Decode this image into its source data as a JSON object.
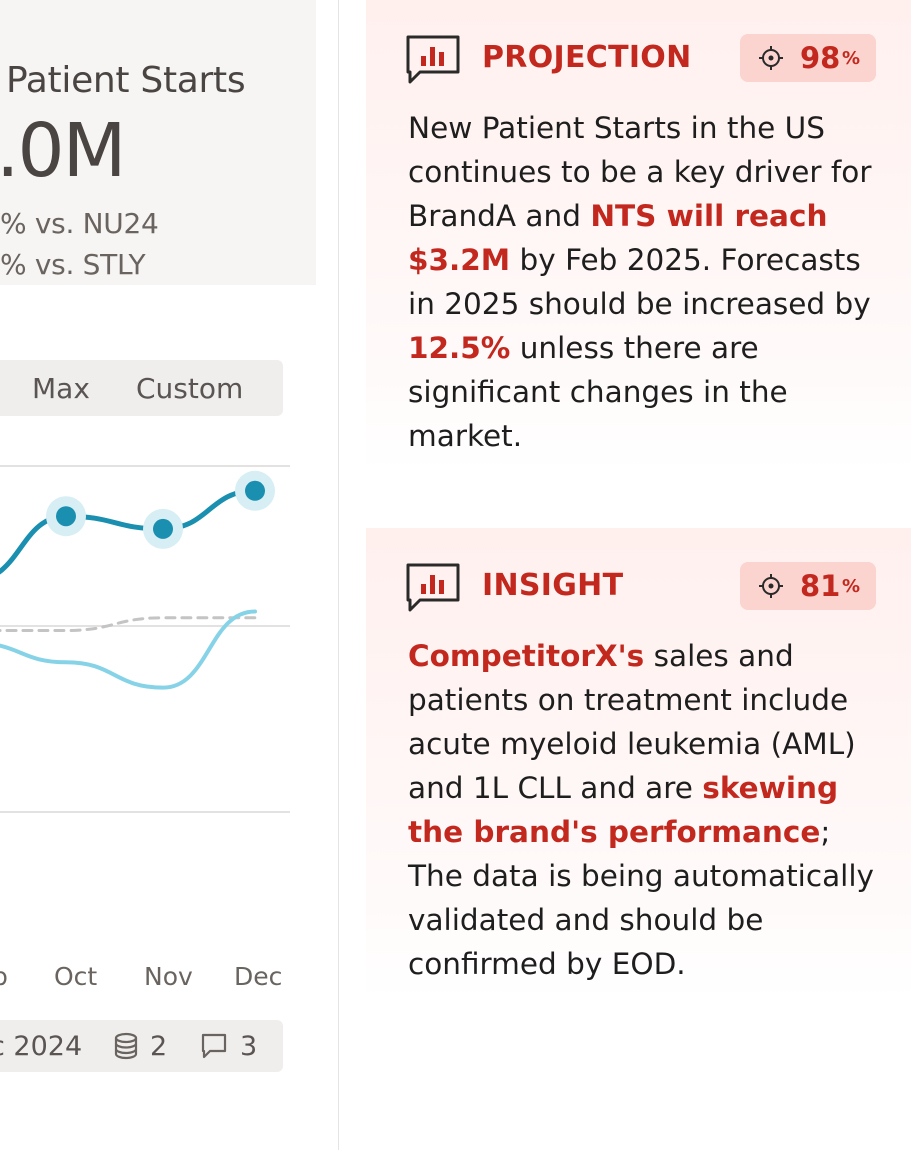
{
  "kpi": {
    "title": "Patient Starts",
    "value": ".0M",
    "delta_nu24": "% vs. NU24",
    "delta_stly": "% vs. STLY"
  },
  "range_selector": {
    "options": [
      "Max",
      "Custom"
    ]
  },
  "chart_data": {
    "type": "line",
    "categories": [
      "p",
      "Oct",
      "Nov",
      "Dec"
    ],
    "series": [
      {
        "values": [
          58,
          68,
          66,
          72
        ],
        "color": "#1a8fb0",
        "style": "solid-markers"
      },
      {
        "values": [
          48,
          45,
          41,
          53
        ],
        "color": "#86d3e8",
        "style": "solid"
      },
      {
        "values": [
          50,
          50,
          52,
          52
        ],
        "color": "#c4c4c4",
        "style": "dashed"
      }
    ],
    "ylim": [
      0,
      80
    ],
    "grid": true
  },
  "footer": {
    "date": "c 2024",
    "datasources_count": "2",
    "comments_count": "3",
    "datasource_icon": "database-icon",
    "comments_icon": "comment-icon"
  },
  "cards": [
    {
      "label": "PROJECTION",
      "icon": "bar-chart-message-icon",
      "confidence": "98",
      "confidence_unit": "%",
      "text": {
        "p1": "New Patient Starts in the US continues to be a key driver for BrandA and ",
        "h1": "NTS will reach $3.2M",
        "p2": " by Feb 2025. Forecasts in 2025 should be increased by ",
        "h2": "12.5%",
        "p3": " unless there are significant changes in the market."
      }
    },
    {
      "label": "INSIGHT",
      "icon": "bar-chart-message-icon",
      "confidence": "81",
      "confidence_unit": "%",
      "text": {
        "h1": "CompetitorX's",
        "p1": " sales and patients on treatment include acute myeloid leukemia (AML) and 1L CLL and are ",
        "h2": "skewing the brand's performance",
        "p2": "; The data is being automatically validated and should be confirmed by EOD."
      }
    }
  ],
  "colors": {
    "accent_red": "#c2281e",
    "badge_bg": "#fbd3cf",
    "line_primary": "#1a8fb0",
    "line_secondary": "#86d3e8"
  }
}
